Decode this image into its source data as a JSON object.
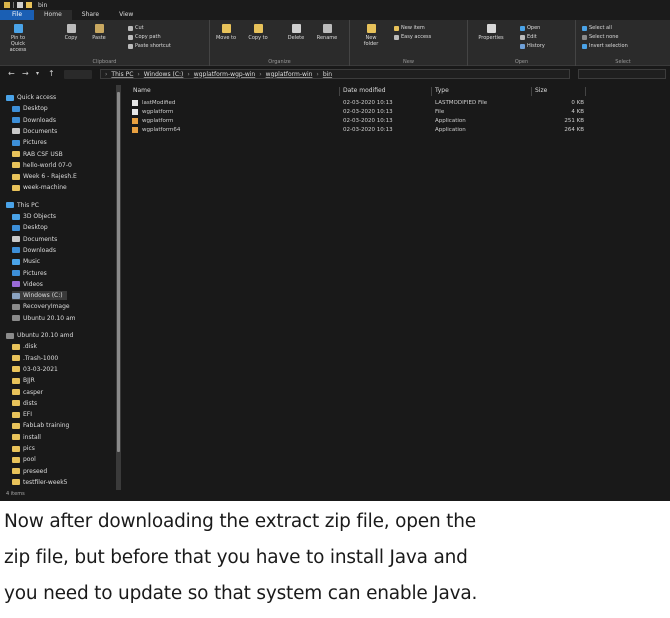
{
  "window": {
    "title": "bin"
  },
  "ribbon": {
    "tabs": [
      "File",
      "Home",
      "Share",
      "View"
    ],
    "clipboard": {
      "pin": "Pin to Quick access",
      "copy": "Copy",
      "paste": "Paste",
      "cut": "Cut",
      "copy_path": "Copy path",
      "paste_shortcut": "Paste shortcut",
      "label": "Clipboard"
    },
    "organize": {
      "move_to": "Move to",
      "copy_to": "Copy to",
      "delete": "Delete",
      "rename": "Rename",
      "label": "Organize"
    },
    "new": {
      "new_folder": "New folder",
      "new_item": "New item",
      "easy_access": "Easy access",
      "label": "New"
    },
    "open": {
      "properties": "Properties",
      "open": "Open",
      "edit": "Edit",
      "history": "History",
      "label": "Open"
    },
    "select": {
      "select_all": "Select all",
      "select_none": "Select none",
      "invert_selection": "Invert selection",
      "label": "Select"
    }
  },
  "address": {
    "crumbs": [
      "This PC",
      "Windows (C:)",
      "wgplatform-wgp-win",
      "wgplatform-win",
      "bin"
    ]
  },
  "sidebar": {
    "items": [
      {
        "label": "Quick access",
        "icon": "star-icon",
        "color": "#4aa3e8"
      },
      {
        "label": "Desktop",
        "icon": "desktop-icon",
        "color": "#3d8fd8"
      },
      {
        "label": "Downloads",
        "icon": "download-icon",
        "color": "#3d8fd8"
      },
      {
        "label": "Documents",
        "icon": "documents-icon",
        "color": "#c9c9c9"
      },
      {
        "label": "Pictures",
        "icon": "pictures-icon",
        "color": "#3d8fd8"
      },
      {
        "label": "RAB CSF USB",
        "icon": "folder-icon",
        "color": "#e8c25a"
      },
      {
        "label": "hello-world 07-0",
        "icon": "folder-icon",
        "color": "#e8c25a"
      },
      {
        "label": "Week 6 - Rajesh.E",
        "icon": "folder-icon",
        "color": "#e8c25a"
      },
      {
        "label": "week-machine",
        "icon": "folder-icon",
        "color": "#e8c25a"
      },
      {
        "label": "This PC",
        "icon": "pc-icon",
        "color": "#4aa3e8"
      },
      {
        "label": "3D Objects",
        "icon": "3d-objects-icon",
        "color": "#4aa3e8"
      },
      {
        "label": "Desktop",
        "icon": "desktop-icon",
        "color": "#3d8fd8"
      },
      {
        "label": "Documents",
        "icon": "documents-icon",
        "color": "#c9c9c9"
      },
      {
        "label": "Downloads",
        "icon": "download-icon",
        "color": "#3d8fd8"
      },
      {
        "label": "Music",
        "icon": "music-icon",
        "color": "#4aa3e8"
      },
      {
        "label": "Pictures",
        "icon": "pictures-icon",
        "color": "#3d8fd8"
      },
      {
        "label": "Videos",
        "icon": "videos-icon",
        "color": "#9a6ad8"
      },
      {
        "label": "Windows (C:)",
        "icon": "drive-icon",
        "color": "#8aa2c0"
      },
      {
        "label": "RecoveryImage",
        "icon": "drive-icon",
        "color": "#8a8a8a"
      },
      {
        "label": "Ubuntu 20.10 am",
        "icon": "drive-icon",
        "color": "#8a8a8a"
      },
      {
        "label": "Ubuntu 20.10 amd",
        "icon": "drive-icon",
        "color": "#8a8a8a"
      },
      {
        "label": ".disk",
        "icon": "folder-icon",
        "color": "#e8c25a"
      },
      {
        "label": ".Trash-1000",
        "icon": "folder-icon",
        "color": "#e8c25a"
      },
      {
        "label": "03-03-2021",
        "icon": "folder-icon",
        "color": "#e8c25a"
      },
      {
        "label": "BJJR",
        "icon": "folder-icon",
        "color": "#e8c25a"
      },
      {
        "label": "casper",
        "icon": "folder-icon",
        "color": "#e8c25a"
      },
      {
        "label": "dists",
        "icon": "folder-icon",
        "color": "#e8c25a"
      },
      {
        "label": "EFI",
        "icon": "folder-icon",
        "color": "#e8c25a"
      },
      {
        "label": "FabLab training",
        "icon": "folder-icon",
        "color": "#e8c25a"
      },
      {
        "label": "install",
        "icon": "folder-icon",
        "color": "#e8c25a"
      },
      {
        "label": "pics",
        "icon": "folder-icon",
        "color": "#e8c25a"
      },
      {
        "label": "pool",
        "icon": "folder-icon",
        "color": "#e8c25a"
      },
      {
        "label": "preseed",
        "icon": "folder-icon",
        "color": "#e8c25a"
      },
      {
        "label": "testfiler-week5",
        "icon": "folder-icon",
        "color": "#e8c25a"
      }
    ]
  },
  "files": {
    "columns": [
      "Name",
      "Date modified",
      "Type",
      "Size"
    ],
    "rows": [
      {
        "name": "lastModified",
        "date": "02-03-2020 10:13",
        "type": "LASTMODIFIED File",
        "size": "0 KB",
        "icon": "file-icon",
        "color": "#e6e6e6"
      },
      {
        "name": "wgplatform",
        "date": "02-03-2020 10:13",
        "type": "File",
        "size": "4 KB",
        "icon": "file-icon",
        "color": "#e6e6e6"
      },
      {
        "name": "wgplatform",
        "date": "02-03-2020 10:13",
        "type": "Application",
        "size": "251 KB",
        "icon": "app-icon",
        "color": "#e8a040"
      },
      {
        "name": "wgplatform64",
        "date": "02-03-2020 10:13",
        "type": "Application",
        "size": "264 KB",
        "icon": "app-icon",
        "color": "#e8a040"
      }
    ]
  },
  "status": {
    "text": "4 items"
  },
  "caption": {
    "line1": "Now after downloading the extract zip file, open the",
    "line2": "zip file, but before that you have to install Java and",
    "line3": "you need to update so that system can enable Java."
  }
}
